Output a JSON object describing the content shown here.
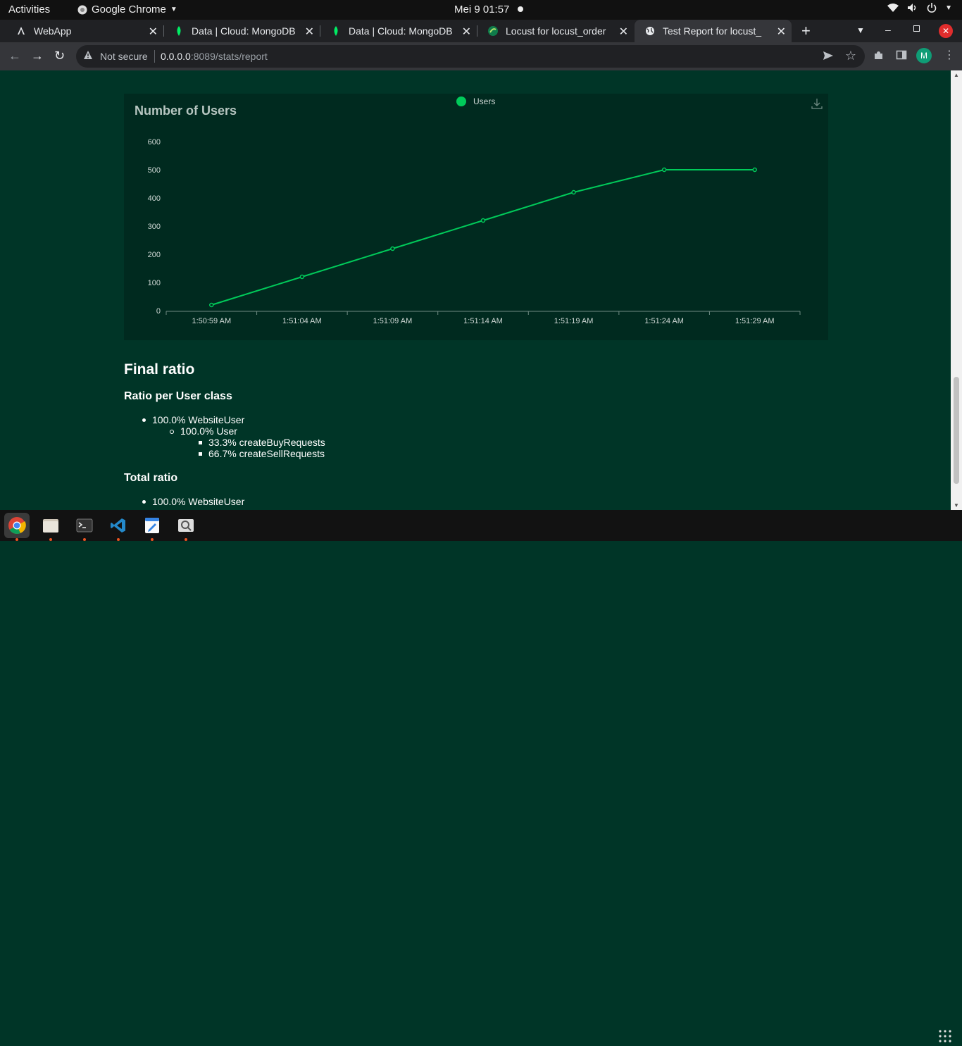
{
  "system_bar": {
    "activities": "Activities",
    "app_name": "Google Chrome",
    "datetime": "Mei 9  01:57"
  },
  "tabs": [
    {
      "title": "WebApp",
      "icon": "angular-icon"
    },
    {
      "title": "Data | Cloud: MongoDB",
      "icon": "mongodb-leaf-icon"
    },
    {
      "title": "Data | Cloud: MongoDB",
      "icon": "mongodb-leaf-icon"
    },
    {
      "title": "Locust for locust_order",
      "icon": "locust-icon"
    },
    {
      "title": "Test Report for locust_",
      "icon": "globe-icon",
      "active": true
    }
  ],
  "address_bar": {
    "security_label": "Not secure",
    "url_host": "0.0.0.0",
    "url_rest": ":8089/stats/report"
  },
  "profile_initial": "M",
  "chart": {
    "title": "Number of Users",
    "legend_label": "Users"
  },
  "chart_data": {
    "type": "line",
    "title": "Number of Users",
    "x": [
      "1:50:59 AM",
      "1:51:04 AM",
      "1:51:09 AM",
      "1:51:14 AM",
      "1:51:19 AM",
      "1:51:24 AM",
      "1:51:29 AM"
    ],
    "series": [
      {
        "name": "Users",
        "values": [
          20,
          120,
          220,
          320,
          420,
          500,
          500
        ],
        "color": "#00ca5a"
      }
    ],
    "y_ticks": [
      0,
      100,
      200,
      300,
      400,
      500,
      600
    ],
    "ylim": [
      0,
      600
    ],
    "legend": "top-center",
    "grid": false
  },
  "final_ratio": {
    "heading": "Final ratio",
    "per_class_heading": "Ratio per User class",
    "per_class": {
      "level1": "100.0% WebsiteUser",
      "level2": "100.0% User",
      "level3": [
        "33.3% createBuyRequests",
        "66.7% createSellRequests"
      ]
    },
    "total_heading": "Total ratio",
    "total": {
      "level1": "100.0% WebsiteUser"
    }
  },
  "colors": {
    "page_bg": "#003527",
    "chart_bg": "#002a1f",
    "series": "#00ca5a"
  }
}
